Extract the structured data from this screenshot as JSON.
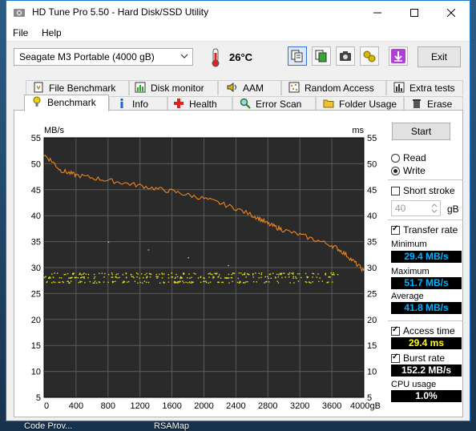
{
  "desktop": {
    "labels": [
      "Code Prov...",
      "RSAMap"
    ]
  },
  "window": {
    "title": "HD Tune Pro 5.50 - Hard Disk/SSD Utility",
    "icons": {
      "app": "hd-tune-app-icon",
      "minimize": "minimize-icon",
      "maximize": "maximize-icon",
      "close": "close-icon"
    }
  },
  "menu": {
    "file": "File",
    "help": "Help"
  },
  "toolbar": {
    "drive": "Seagate M3 Portable (4000 gB)",
    "temperature": "26°C",
    "buttons": [
      "copy-text-icon",
      "copy-screenshot-icon",
      "camera-icon",
      "options-icon",
      "save-download-icon"
    ],
    "exit": "Exit"
  },
  "tabs": {
    "row1": [
      "File Benchmark",
      "Disk monitor",
      "AAM",
      "Random Access",
      "Extra tests"
    ],
    "row2": [
      "Benchmark",
      "Info",
      "Health",
      "Error Scan",
      "Folder Usage",
      "Erase"
    ],
    "active": "Benchmark"
  },
  "controls": {
    "start": "Start",
    "read": "Read",
    "write": "Write",
    "mode_selected": "Write",
    "short_stroke": "Short stroke",
    "short_stroke_checked": false,
    "short_stroke_value": "40",
    "short_stroke_unit": "gB",
    "transfer_rate": "Transfer rate",
    "transfer_rate_checked": true,
    "minimum_label": "Minimum",
    "minimum": "29.4 MB/s",
    "maximum_label": "Maximum",
    "maximum": "51.7 MB/s",
    "average_label": "Average",
    "average": "41.8 MB/s",
    "access_time": "Access time",
    "access_time_checked": true,
    "access_time_value": "29.4 ms",
    "burst_rate": "Burst rate",
    "burst_rate_checked": true,
    "burst_rate_value": "152.2 MB/s",
    "cpu_usage_label": "CPU usage",
    "cpu_usage": "1.0%"
  },
  "colors": {
    "chart_bg": "#2a2a2a",
    "grid": "#5a5a5a",
    "transfer": "#ff8c1a",
    "access": "#e6e619",
    "value_blue": "#00b4ff",
    "value_yellow": "#ffff00",
    "value_white": "#ffffff"
  },
  "chart_data": {
    "type": "line",
    "xlabel": "gB",
    "ylabel_left": "MB/s",
    "ylabel_right": "ms",
    "x_ticks": [
      0,
      400,
      800,
      1200,
      1600,
      2000,
      2400,
      2800,
      3200,
      3600,
      4000
    ],
    "x_tick_labels": [
      "0",
      "400",
      "800",
      "1200",
      "1600",
      "2000",
      "2400",
      "2800",
      "3200",
      "3600",
      "4000gB"
    ],
    "y_ticks": [
      5,
      10,
      15,
      20,
      25,
      30,
      35,
      40,
      45,
      50,
      55
    ],
    "xlim": [
      0,
      4000
    ],
    "ylim": [
      5,
      55
    ],
    "grid": true,
    "series": [
      {
        "name": "Transfer rate",
        "axis": "MB/s",
        "x": [
          0,
          100,
          200,
          300,
          400,
          600,
          800,
          1000,
          1200,
          1400,
          1600,
          1800,
          2000,
          2200,
          2400,
          2600,
          2700,
          2800,
          2900,
          3000,
          3200,
          3400,
          3600,
          3700,
          3800,
          3900,
          4000
        ],
        "values": [
          51.7,
          50.5,
          48.8,
          48.3,
          47.8,
          47.3,
          46.8,
          46.3,
          45.8,
          45.2,
          44.7,
          44.0,
          43.3,
          42.4,
          41.4,
          40.1,
          39.4,
          38.4,
          37.8,
          37.2,
          36.3,
          35.3,
          34.3,
          33.4,
          32.2,
          30.8,
          29.4
        ]
      },
      {
        "name": "Access time",
        "axis": "ms",
        "type": "scatter",
        "bands": [
          27.3,
          28.2,
          28.9
        ],
        "x_range": [
          0,
          3700
        ]
      }
    ]
  }
}
